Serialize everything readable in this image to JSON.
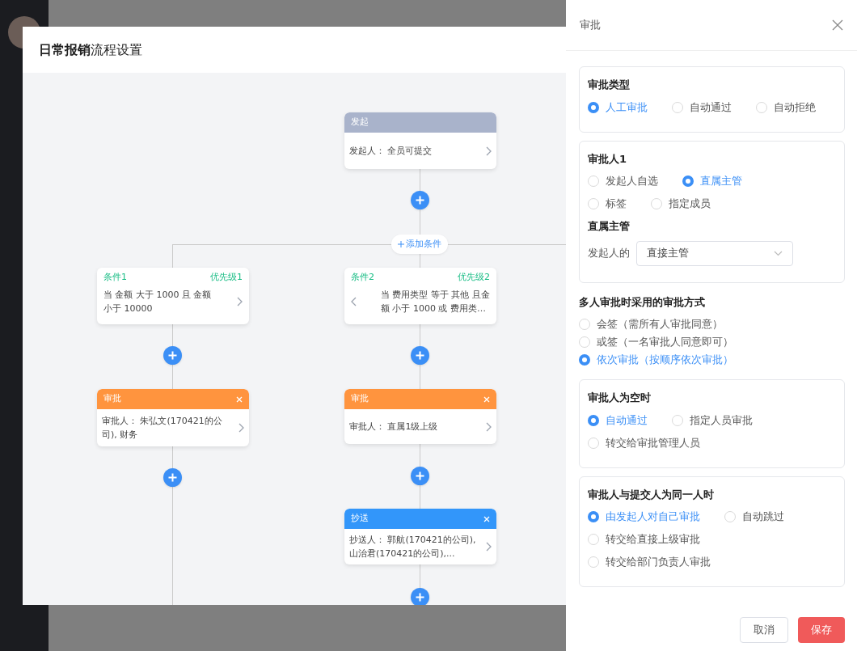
{
  "modal": {
    "title": "**日常报销**流程设置"
  },
  "flow": {
    "add_condition": "添加条件",
    "nodes": [
      {
        "kind": "start",
        "title": "发起",
        "text": "发起人：  全员可提交",
        "left_arrow": false,
        "right_arrow": true
      },
      {
        "kind": "condition",
        "title": "条件1",
        "priority": "优先级1",
        "text": "当 金额 大于 1000 且 金额小于 10000",
        "left_arrow": false,
        "right_arrow": true
      },
      {
        "kind": "condition",
        "title": "条件2",
        "priority": "优先级2",
        "text": "当 费用类型 等于 其他 且金额 小于 1000 或 费用类…",
        "left_arrow": true,
        "right_arrow": false
      },
      {
        "kind": "approver",
        "title": "审批",
        "text": "审批人：  朱弘文(170421的公司), 财务",
        "left_arrow": false,
        "right_arrow": true
      },
      {
        "kind": "approver",
        "title": "审批",
        "text": "审批人：  直属1级上级",
        "left_arrow": false,
        "right_arrow": true
      },
      {
        "kind": "cc",
        "title": "抄送",
        "text": "抄送人：  郭航(170421的公司), 山治君(170421的公司),...",
        "left_arrow": false,
        "right_arrow": true
      }
    ]
  },
  "drawer": {
    "title": "审批",
    "sections": [
      {
        "kind": "card",
        "title": "审批类型",
        "rows": [
          [
            {
              "label": "人工审批",
              "selected": true
            },
            {
              "label": "自动通过",
              "selected": false
            },
            {
              "label": "自动拒绝",
              "selected": false
            }
          ]
        ]
      },
      {
        "kind": "card",
        "title": "审批人1",
        "rows": [
          [
            {
              "label": "发起人自选",
              "selected": false
            },
            {
              "label": "直属主管",
              "selected": true
            }
          ],
          [
            {
              "label": "标签",
              "selected": false
            },
            {
              "label": "指定成员",
              "selected": false
            }
          ]
        ],
        "sub_title": "直属主管",
        "select": {
          "label": "发起人的",
          "value": "直接主管"
        }
      },
      {
        "kind": "plain",
        "title": "多人审批时采用的审批方式",
        "rows": [
          [
            {
              "label": "会签（需所有人审批同意）",
              "selected": false
            }
          ],
          [
            {
              "label": "或签（一名审批人同意即可）",
              "selected": false
            }
          ],
          [
            {
              "label": "依次审批（按顺序依次审批）",
              "selected": true
            }
          ]
        ]
      },
      {
        "kind": "card",
        "title": "审批人为空时",
        "rows": [
          [
            {
              "label": "自动通过",
              "selected": true
            },
            {
              "label": "指定人员审批",
              "selected": false
            }
          ],
          [
            {
              "label": "转交给审批管理人员",
              "selected": false
            }
          ]
        ]
      },
      {
        "kind": "card",
        "title": "审批人与提交人为同一人时",
        "rows": [
          [
            {
              "label": "由发起人对自己审批",
              "selected": true
            },
            {
              "label": "自动跳过",
              "selected": false
            }
          ],
          [
            {
              "label": "转交给直接上级审批",
              "selected": false
            }
          ],
          [
            {
              "label": "转交给部门负责人审批",
              "selected": false
            }
          ]
        ]
      }
    ],
    "buttons": [
      {
        "kind": "secondary",
        "label": "取消"
      },
      {
        "kind": "primary",
        "label": "保存"
      }
    ]
  }
}
